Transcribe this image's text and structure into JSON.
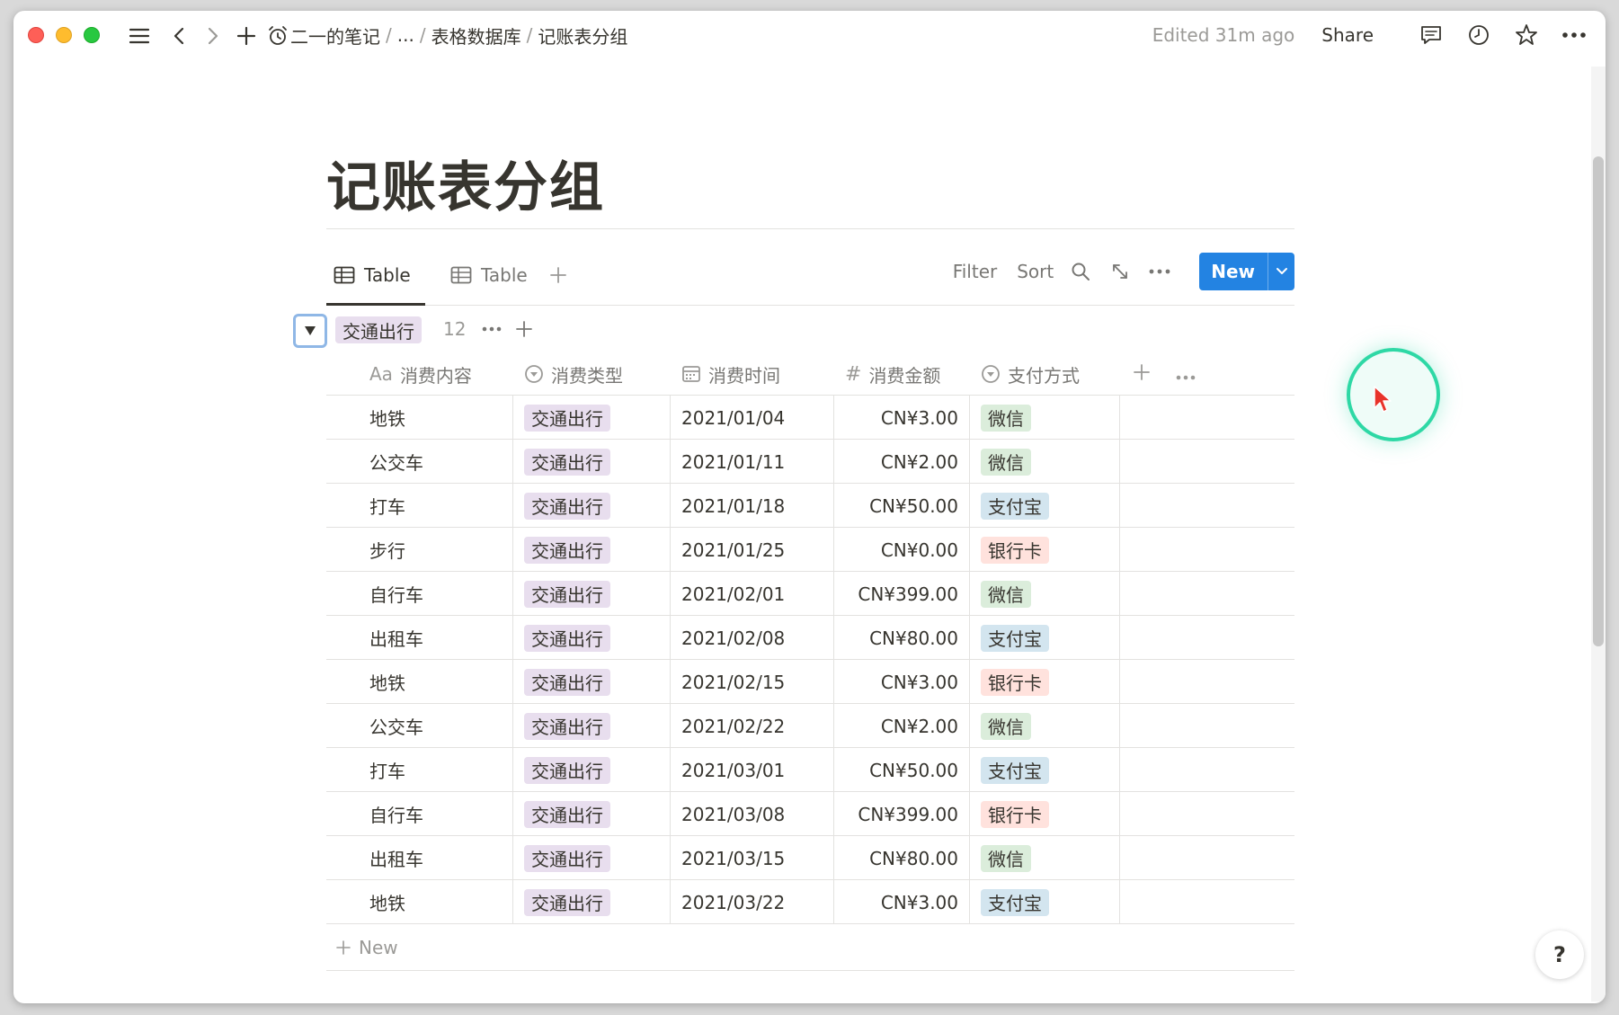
{
  "breadcrumb": {
    "items": [
      "二一的笔记",
      "...",
      "表格数据库",
      "记账表分组"
    ]
  },
  "topbar": {
    "edited": "Edited 31m ago",
    "share": "Share"
  },
  "page": {
    "title": "记账表分组"
  },
  "views": {
    "tabs": [
      {
        "label": "Table",
        "active": true
      },
      {
        "label": "Table",
        "active": false
      }
    ]
  },
  "toolbar": {
    "filter": "Filter",
    "sort": "Sort",
    "new_label": "New"
  },
  "group": {
    "label": "交通出行",
    "count": "12"
  },
  "table": {
    "columns": [
      {
        "label": "消费内容",
        "icon": "Aa"
      },
      {
        "label": "消费类型",
        "icon": "select-icon"
      },
      {
        "label": "消费时间",
        "icon": "calendar-icon"
      },
      {
        "label": "消费金额",
        "icon": "#"
      },
      {
        "label": "支付方式",
        "icon": "select-icon"
      }
    ],
    "rows": [
      {
        "name": "地铁",
        "type": "交通出行",
        "date": "2021/01/04",
        "amount": "CN¥3.00",
        "pay": "微信",
        "pay_color": "green"
      },
      {
        "name": "公交车",
        "type": "交通出行",
        "date": "2021/01/11",
        "amount": "CN¥2.00",
        "pay": "微信",
        "pay_color": "green"
      },
      {
        "name": "打车",
        "type": "交通出行",
        "date": "2021/01/18",
        "amount": "CN¥50.00",
        "pay": "支付宝",
        "pay_color": "blue"
      },
      {
        "name": "步行",
        "type": "交通出行",
        "date": "2021/01/25",
        "amount": "CN¥0.00",
        "pay": "银行卡",
        "pay_color": "red"
      },
      {
        "name": "自行车",
        "type": "交通出行",
        "date": "2021/02/01",
        "amount": "CN¥399.00",
        "pay": "微信",
        "pay_color": "green"
      },
      {
        "name": "出租车",
        "type": "交通出行",
        "date": "2021/02/08",
        "amount": "CN¥80.00",
        "pay": "支付宝",
        "pay_color": "blue"
      },
      {
        "name": "地铁",
        "type": "交通出行",
        "date": "2021/02/15",
        "amount": "CN¥3.00",
        "pay": "银行卡",
        "pay_color": "red"
      },
      {
        "name": "公交车",
        "type": "交通出行",
        "date": "2021/02/22",
        "amount": "CN¥2.00",
        "pay": "微信",
        "pay_color": "green"
      },
      {
        "name": "打车",
        "type": "交通出行",
        "date": "2021/03/01",
        "amount": "CN¥50.00",
        "pay": "支付宝",
        "pay_color": "blue"
      },
      {
        "name": "自行车",
        "type": "交通出行",
        "date": "2021/03/08",
        "amount": "CN¥399.00",
        "pay": "银行卡",
        "pay_color": "red"
      },
      {
        "name": "出租车",
        "type": "交通出行",
        "date": "2021/03/15",
        "amount": "CN¥80.00",
        "pay": "微信",
        "pay_color": "green"
      },
      {
        "name": "地铁",
        "type": "交通出行",
        "date": "2021/03/22",
        "amount": "CN¥3.00",
        "pay": "支付宝",
        "pay_color": "blue"
      }
    ],
    "new_row_label": "New"
  },
  "help": {
    "label": "?"
  },
  "colors": {
    "accent": "#2383e2",
    "tag_purple": "#e8deee",
    "tag_green": "#dbeddb",
    "tag_blue": "#d3e5ef",
    "tag_red": "#ffe2dd",
    "cursor_ring": "#2ed8a5"
  }
}
